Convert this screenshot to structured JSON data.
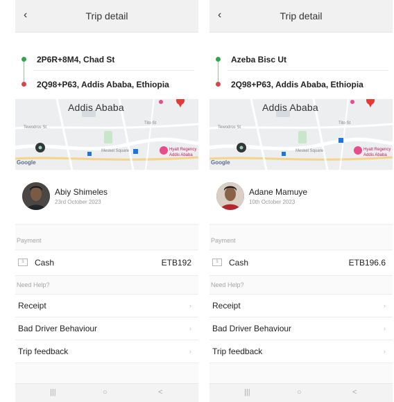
{
  "screens": [
    {
      "header": {
        "back_icon": "chevron-left-icon",
        "title": "Trip detail"
      },
      "route": {
        "pickup": "2P6R+8M4, Chad St",
        "dropoff": "2Q98+P63, Addis Ababa, Ethiopia"
      },
      "map": {
        "city_label": "Addis Ababa",
        "google": "Google"
      },
      "driver": {
        "name": "Abiy Shimeles",
        "date": "23rd October 2023"
      },
      "payment": {
        "section_label": "Payment",
        "method": "Cash",
        "amount": "ETB192"
      },
      "help": {
        "section_label": "Need Help?",
        "items": [
          "Receipt",
          "Bad Driver Behaviour",
          "Trip feedback"
        ]
      },
      "navbar": {
        "recent": "|||",
        "home": "○",
        "back": "<"
      }
    },
    {
      "header": {
        "back_icon": "chevron-left-icon",
        "title": "Trip detail"
      },
      "route": {
        "pickup": "Azeba Bisc Ut",
        "dropoff": "2Q98+P63, Addis Ababa, Ethiopia"
      },
      "map": {
        "city_label": "Addis Ababa",
        "google": "Google"
      },
      "driver": {
        "name": "Adane Mamuye",
        "date": "10th October 2023"
      },
      "payment": {
        "section_label": "Payment",
        "method": "Cash",
        "amount": "ETB196.6"
      },
      "help": {
        "section_label": "Need Help?",
        "items": [
          "Receipt",
          "Bad Driver Behaviour",
          "Trip feedback"
        ]
      },
      "navbar": {
        "recent": "|||",
        "home": "○",
        "back": "<"
      }
    }
  ],
  "colors": {
    "pickup_dot": "#2ea84a",
    "dropoff_dot": "#d9464a",
    "header_bg": "#f1f1f1"
  }
}
